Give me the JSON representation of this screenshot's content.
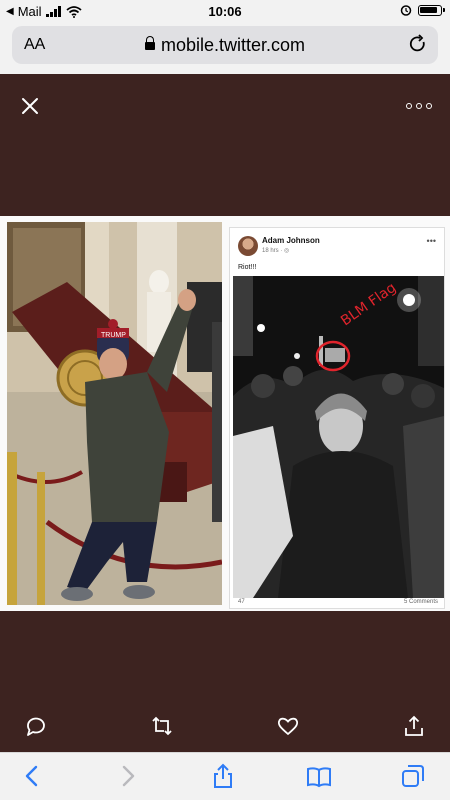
{
  "status_bar": {
    "back_app": "Mail",
    "time": "10:06"
  },
  "browser": {
    "reader_label": "AA",
    "url": "mobile.twitter.com"
  },
  "embedded_post": {
    "author": "Adam Johnson",
    "meta": "18 hrs · ◎",
    "text": "Riot!!!",
    "annotation": "BLM Flag",
    "reaction_count": "47",
    "comments": "5 Comments",
    "podium_sign": "TRUMP"
  },
  "colors": {
    "viewer_bg": "#3d2320",
    "annotation_red": "#e0242c",
    "safari_blue": "#2f7cf6"
  }
}
